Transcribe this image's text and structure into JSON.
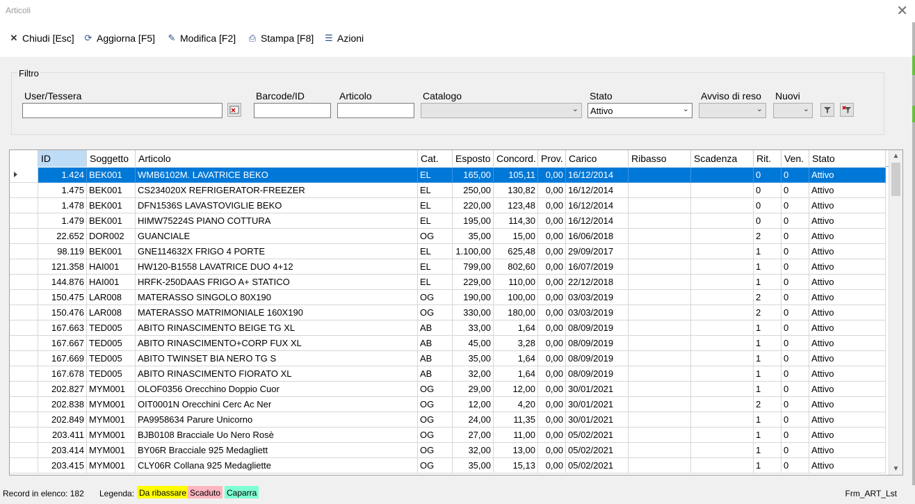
{
  "window": {
    "title": "Articoli",
    "close_glyph": "✕"
  },
  "toolbar": [
    {
      "label": "Chiudi [Esc]",
      "icon": "close-icon",
      "glyph": "✕"
    },
    {
      "label": "Aggiorna [F5]",
      "icon": "refresh-icon",
      "glyph": "⟳"
    },
    {
      "label": "Modifica [F2]",
      "icon": "edit-icon",
      "glyph": "✎"
    },
    {
      "label": "Stampa [F8]",
      "icon": "print-icon",
      "glyph": "⎙"
    },
    {
      "label": "Azioni",
      "icon": "actions-icon",
      "glyph": "☰"
    }
  ],
  "filter": {
    "title": "Filtro",
    "user_label": "User/Tessera",
    "user_value": "",
    "barcode_label": "Barcode/ID",
    "barcode_value": "",
    "articolo_label": "Articolo",
    "articolo_value": "",
    "catalogo_label": "Catalogo",
    "catalogo_value": "",
    "stato_label": "Stato",
    "stato_value": "Attivo",
    "avviso_label": "Avviso di reso",
    "avviso_value": "",
    "nuovi_label": "Nuovi",
    "nuovi_value": ""
  },
  "table": {
    "columns": [
      "",
      "ID",
      "Soggetto",
      "Articolo",
      "Cat.",
      "Esposto",
      "Concord.",
      "Prov.",
      "Carico",
      "Ribasso",
      "Scadenza",
      "Rit.",
      "Ven.",
      "Stato"
    ],
    "selected_index": 0,
    "rows": [
      [
        "1.424",
        "BEK001",
        "WMB6102M. LAVATRICE BEKO",
        "EL",
        "165,00",
        "105,11",
        "0,00",
        "16/12/2014",
        "",
        "",
        "0",
        "0",
        "Attivo"
      ],
      [
        "1.475",
        "BEK001",
        "CS234020X REFRIGERATOR-FREEZER",
        "EL",
        "250,00",
        "130,82",
        "0,00",
        "16/12/2014",
        "",
        "",
        "0",
        "0",
        "Attivo"
      ],
      [
        "1.478",
        "BEK001",
        "DFN1536S LAVASTOVIGLIE BEKO",
        "EL",
        "220,00",
        "123,48",
        "0,00",
        "16/12/2014",
        "",
        "",
        "0",
        "0",
        "Attivo"
      ],
      [
        "1.479",
        "BEK001",
        "HIMW75224S PIANO COTTURA",
        "EL",
        "195,00",
        "114,30",
        "0,00",
        "16/12/2014",
        "",
        "",
        "0",
        "0",
        "Attivo"
      ],
      [
        "22.652",
        "DOR002",
        "GUANCIALE",
        "OG",
        "35,00",
        "15,00",
        "0,00",
        "16/06/2018",
        "",
        "",
        "2",
        "0",
        "Attivo"
      ],
      [
        "98.119",
        "BEK001",
        "GNE114632X FRIGO 4 PORTE",
        "EL",
        "1.100,00",
        "625,48",
        "0,00",
        "29/09/2017",
        "",
        "",
        "1",
        "0",
        "Attivo"
      ],
      [
        "121.358",
        "HAI001",
        "HW120-B1558 LAVATRICE DUO 4+12",
        "EL",
        "799,00",
        "802,60",
        "0,00",
        "16/07/2019",
        "",
        "",
        "1",
        "0",
        "Attivo"
      ],
      [
        "144.876",
        "HAI001",
        "HRFK-250DAAS FRIGO A+ STATICO",
        "EL",
        "229,00",
        "110,00",
        "0,00",
        "22/12/2018",
        "",
        "",
        "1",
        "0",
        "Attivo"
      ],
      [
        "150.475",
        "LAR008",
        "MATERASSO SINGOLO 80X190",
        "OG",
        "190,00",
        "100,00",
        "0,00",
        "03/03/2019",
        "",
        "",
        "2",
        "0",
        "Attivo"
      ],
      [
        "150.476",
        "LAR008",
        "MATERASSO MATRIMONIALE 160X190",
        "OG",
        "330,00",
        "180,00",
        "0,00",
        "03/03/2019",
        "",
        "",
        "2",
        "0",
        "Attivo"
      ],
      [
        "167.663",
        "TED005",
        "ABITO RINASCIMENTO BEIGE TG XL",
        "AB",
        "33,00",
        "1,64",
        "0,00",
        "08/09/2019",
        "",
        "",
        "1",
        "0",
        "Attivo"
      ],
      [
        "167.667",
        "TED005",
        "ABITO RINASCIMENTO+CORP FUX XL",
        "AB",
        "45,00",
        "3,28",
        "0,00",
        "08/09/2019",
        "",
        "",
        "1",
        "0",
        "Attivo"
      ],
      [
        "167.669",
        "TED005",
        "ABITO TWINSET BIA NERO TG S",
        "AB",
        "35,00",
        "1,64",
        "0,00",
        "08/09/2019",
        "",
        "",
        "1",
        "0",
        "Attivo"
      ],
      [
        "167.678",
        "TED005",
        "ABITO RINASCIMENTO FIORATO XL",
        "AB",
        "32,00",
        "1,64",
        "0,00",
        "08/09/2019",
        "",
        "",
        "1",
        "0",
        "Attivo"
      ],
      [
        "202.827",
        "MYM001",
        "OLOF0356 Orecchino Doppio Cuor",
        "OG",
        "29,00",
        "12,00",
        "0,00",
        "30/01/2021",
        "",
        "",
        "1",
        "0",
        "Attivo"
      ],
      [
        "202.838",
        "MYM001",
        "OIT0001N Orecchini Cerc Ac Ner",
        "OG",
        "12,00",
        "4,20",
        "0,00",
        "30/01/2021",
        "",
        "",
        "2",
        "0",
        "Attivo"
      ],
      [
        "202.849",
        "MYM001",
        "PA9958634 Parure Unicorno",
        "OG",
        "24,00",
        "11,35",
        "0,00",
        "30/01/2021",
        "",
        "",
        "1",
        "0",
        "Attivo"
      ],
      [
        "203.411",
        "MYM001",
        "BJB0108 Bracciale Uo Nero Rosè",
        "OG",
        "27,00",
        "11,00",
        "0,00",
        "05/02/2021",
        "",
        "",
        "1",
        "0",
        "Attivo"
      ],
      [
        "203.414",
        "MYM001",
        "BY06R Bracciale 925 Medagliett",
        "OG",
        "32,00",
        "13,00",
        "0,00",
        "05/02/2021",
        "",
        "",
        "1",
        "0",
        "Attivo"
      ],
      [
        "203.415",
        "MYM001",
        "CLY06R Collana 925 Medagliette",
        "OG",
        "35,00",
        "15,13",
        "0,00",
        "05/02/2021",
        "",
        "",
        "1",
        "0",
        "Attivo"
      ]
    ]
  },
  "status": {
    "record_count": "Record in elenco: 182",
    "legend_label": "Legenda:",
    "legend": [
      {
        "label": "Da ribassare",
        "color": "#ffff00"
      },
      {
        "label": "Scaduto",
        "color": "#ffb6c1"
      },
      {
        "label": "Caparra",
        "color": "#7fffd4"
      }
    ],
    "form_name": "Frm_ART_Lst"
  }
}
